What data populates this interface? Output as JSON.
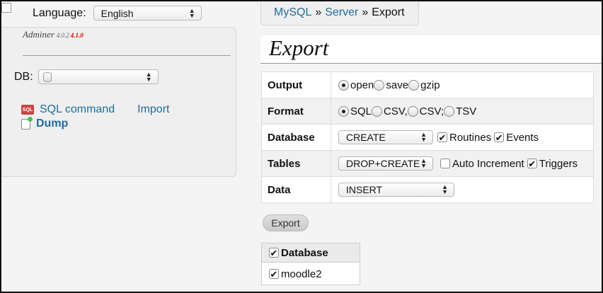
{
  "sidebar": {
    "language_label": "Language:",
    "language_value": "English",
    "app_name": "Adminer",
    "version": "4.0.2",
    "new_version": "4.1.0",
    "db_label": "DB:",
    "db_value": "",
    "sql_icon_text": "SQL",
    "sql_command_label": "SQL command",
    "import_label": "Import",
    "dump_label": "Dump"
  },
  "breadcrumb": {
    "mysql": "MySQL",
    "sep1": "»",
    "server": "Server",
    "sep2": "»",
    "current": "Export"
  },
  "page": {
    "title": "Export"
  },
  "export_form": {
    "output": {
      "label": "Output",
      "options": [
        "open",
        "save",
        "gzip"
      ],
      "selected": "open"
    },
    "format": {
      "label": "Format",
      "options": [
        "SQL",
        "CSV,",
        "CSV;",
        "TSV"
      ],
      "selected": "SQL"
    },
    "database": {
      "label": "Database",
      "select_value": "CREATE",
      "routines_label": "Routines",
      "routines_checked": true,
      "events_label": "Events",
      "events_checked": true
    },
    "tables": {
      "label": "Tables",
      "select_value": "DROP+CREATE",
      "auto_increment_label": "Auto Increment",
      "auto_increment_checked": false,
      "triggers_label": "Triggers",
      "triggers_checked": true
    },
    "data": {
      "label": "Data",
      "select_value": "INSERT"
    },
    "submit_label": "Export"
  },
  "db_list": {
    "header": "Database",
    "header_checked": true,
    "rows": [
      {
        "name": "moodle2",
        "checked": true
      }
    ]
  },
  "icons": {
    "checkmark": "✔",
    "select_arrows": "▲▼"
  }
}
